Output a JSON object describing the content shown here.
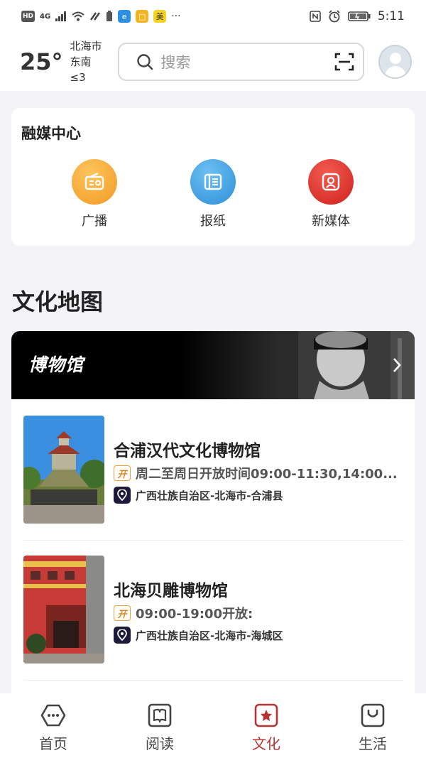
{
  "status_bar": {
    "hd": "HD",
    "network": "4G",
    "app_badge": "美",
    "more": "···",
    "time": "5:11"
  },
  "header": {
    "temperature": "25°",
    "city": "北海市",
    "wind": "东南  ≤3",
    "search_placeholder": "搜索"
  },
  "media_center": {
    "title": "融媒中心",
    "items": [
      {
        "label": "广播",
        "icon": "radio-icon",
        "color": "#f6a52e"
      },
      {
        "label": "报纸",
        "icon": "newspaper-icon",
        "color": "#3fa1e3"
      },
      {
        "label": "新媒体",
        "icon": "new-media-icon",
        "color": "#e0322b"
      }
    ]
  },
  "culture_map": {
    "title": "文化地图",
    "banner_title": "博物馆",
    "museums": [
      {
        "name": "合浦汉代文化博物馆",
        "open_tag": "开",
        "hours": "周二至周日开放时间09:00-11:30,14:00...",
        "address": "广西壮族自治区-北海市-合浦县"
      },
      {
        "name": "北海贝雕博物馆",
        "open_tag": "开",
        "hours": "09:00-19:00开放:",
        "address": "广西壮族自治区-北海市-海城区"
      }
    ]
  },
  "bottom_nav": {
    "items": [
      {
        "label": "首页",
        "icon": "home-icon"
      },
      {
        "label": "阅读",
        "icon": "book-icon"
      },
      {
        "label": "文化",
        "icon": "culture-star-icon",
        "active": true
      },
      {
        "label": "生活",
        "icon": "life-bag-icon"
      }
    ],
    "active_color": "#b53535"
  }
}
